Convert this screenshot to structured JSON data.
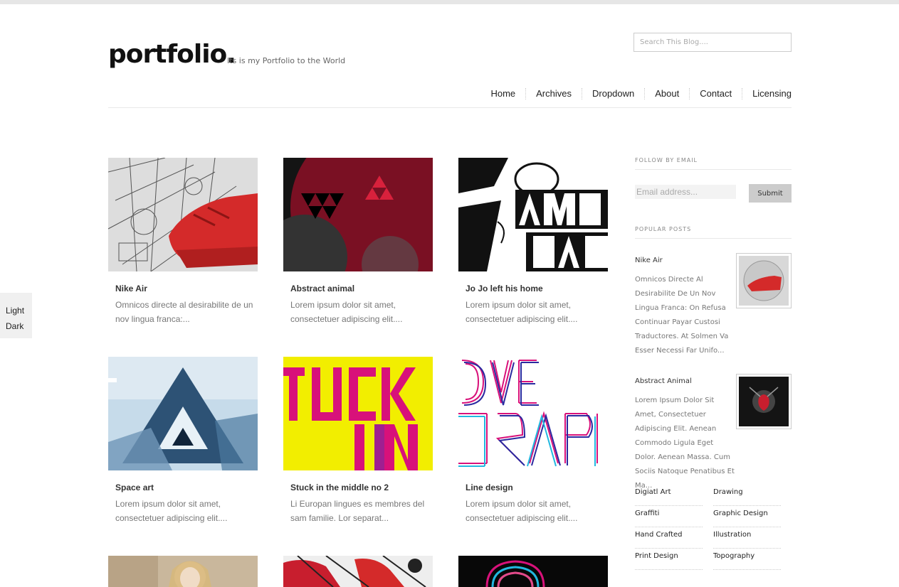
{
  "header": {
    "logo": "portfolio.",
    "tagline": "Its is my Portfolio to the World",
    "search_placeholder": "Search This Blog...."
  },
  "nav": {
    "items": [
      "Home",
      "Archives",
      "Dropdown",
      "About",
      "Contact",
      "Licensing"
    ]
  },
  "style_switcher": {
    "light": "Light",
    "dark": "Dark"
  },
  "posts": [
    {
      "title": "Nike Air",
      "excerpt": "Omnicos directe al desirabilite de un nov lingua franca:..."
    },
    {
      "title": "Abstract animal",
      "excerpt": "Lorem ipsum dolor sit amet, consectetuer adipiscing elit...."
    },
    {
      "title": "Jo Jo left his home",
      "excerpt": "Lorem ipsum dolor sit amet, consectetuer adipiscing elit...."
    },
    {
      "title": "Space art",
      "excerpt": "Lorem ipsum dolor sit amet, consectetuer adipiscing elit...."
    },
    {
      "title": "Stuck in the middle no 2",
      "excerpt": "Li Europan lingues es membres del sam familie. Lor separat..."
    },
    {
      "title": "Line design",
      "excerpt": "Lorem ipsum dolor sit amet, consectetuer adipiscing elit...."
    }
  ],
  "sidebar": {
    "follow_heading": "FOLLOW BY EMAIL",
    "email_placeholder": "Email address...",
    "submit_label": "Submit",
    "popular_heading": "POPULAR POSTS",
    "popular": [
      {
        "title": "Nike Air",
        "text": "Omnicos Directe Al Desirabilite De Un Nov Lingua Franca: On Refusa Continuar Payar Custosi Traductores. At Solmen Va Esser Necessi Far Unifo..."
      },
      {
        "title": "Abstract Animal",
        "text": "Lorem Ipsum Dolor Sit Amet, Consectetuer Adipiscing Elit. Aenean Commodo Ligula Eget Dolor. Aenean Massa. Cum Sociis Natoque Penatibus Et Ma..."
      }
    ],
    "categories": [
      "Digiatl Art",
      "Drawing",
      "Graffiti",
      "Graphic Design",
      "Hand Crafted",
      "Illustration",
      "Print Design",
      "Topography"
    ]
  },
  "colors": {
    "accent_red": "#d42a2a",
    "yellow": "#f2ee00",
    "magenta": "#d8117a"
  }
}
